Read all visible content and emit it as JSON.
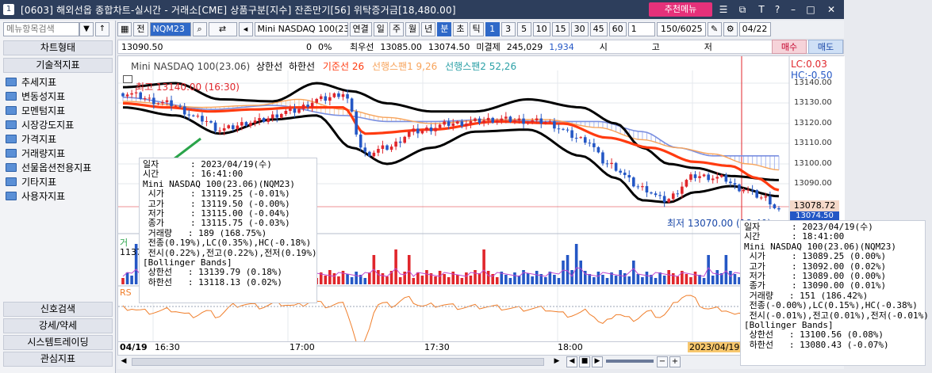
{
  "window": {
    "number": "1",
    "title": "[0603] 해외선옵 종합차트-실시간 - 거래소[CME] 상품구분[지수] 잔존만기[56] 위탁증거금[18,480.00]",
    "recommend_label": "추천메뉴"
  },
  "left_panel": {
    "search_placeholder": "메뉴항목검색",
    "chart_type_label": "차트형태",
    "indicators_label": "기술적지표",
    "tree": [
      "추세지표",
      "변동성지표",
      "모멘텀지표",
      "시장강도지표",
      "가격지표",
      "거래량지표",
      "선물옵션전용지표",
      "기타지표",
      "사용자지표"
    ],
    "bottom": [
      "신호검색",
      "강세/약세",
      "시스템트레이딩",
      "관심지표"
    ]
  },
  "toolbar": {
    "jeon": "전",
    "symbol": "NQM23",
    "name": "Mini NASDAQ 100(23.0",
    "periods": [
      "연결",
      "일",
      "주",
      "월",
      "년",
      "분",
      "초",
      "틱"
    ],
    "selected_period": "분",
    "intervals": [
      "1",
      "3",
      "5",
      "10",
      "15",
      "30",
      "45",
      "60"
    ],
    "selected_interval": "1",
    "interval_value": "1",
    "count": "150/6025",
    "date": "04/22"
  },
  "pricebar": {
    "price": "13090.50",
    "change": "0",
    "pct": "0%",
    "bid_label": "최우선",
    "bid": "13085.00",
    "ask": "13074.50",
    "oi_label": "미결제",
    "oi": "245,029",
    "oi_change": "1,934",
    "open_label": "시",
    "high_label": "고",
    "low_label": "저",
    "buy_label": "매수",
    "sell_label": "매도"
  },
  "chart": {
    "legend_symbol": "Mini NASDAQ 100(23.06)",
    "legend_upper": "상한선",
    "legend_lower": "하한선",
    "legend_kijun": "기준선 26",
    "legend_span1": "선행스팬1 9,26",
    "legend_span2": "선행스팬2 52,26",
    "lc": "LC:0.03",
    "hc": "HC:-0.50",
    "hi_label": "최고 13140.00 (16:30)",
    "lo_label": "최저 13070.00 (18:40)",
    "price_tag": "13078.72",
    "price_tag2": "13074.50",
    "volume_label": "거",
    "volume_val": "1137",
    "rsi_label": "RS",
    "y_ticks": [
      "13140.00",
      "13130.00",
      "13120.00",
      "13110.00",
      "13100.00",
      "13090.00"
    ],
    "x_date": "04/19",
    "x_ticks": [
      "16:30",
      "17:00",
      "17:30",
      "18:00"
    ],
    "x_tag": "2023/04/19("
  },
  "tooltip1": [
    "일자      : 2023/04/19(수)",
    "시간      : 16:41:00",
    "Mini NASDAQ 100(23.06)(NQM23)",
    " 시가     : 13119.25 (-0.01%)",
    " 고가     : 13119.50 (-0.00%)",
    " 저가     : 13115.00 (-0.04%)",
    " 종가     : 13115.75 (-0.03%)",
    " 거래량   : 189 (168.75%)",
    " 전종(0.19%),LC(0.35%),HC(-0.18%)",
    " 전시(0.22%),전고(0.22%),전저(0.19%)",
    "[Bollinger Bands]",
    " 상한선   : 13139.79 (0.18%)",
    " 하한선   : 13118.13 (0.02%)"
  ],
  "tooltip2": [
    "일자      : 2023/04/19(수)",
    "시간      : 18:41:00",
    "Mini NASDAQ 100(23.06)(NQM23)",
    " 시가     : 13089.25 (0.00%)",
    " 고가     : 13092.00 (0.02%)",
    " 저가     : 13089.00 (0.00%)",
    " 종가     : 13090.00 (0.01%)",
    " 거래량   : 151 (186.42%)",
    " 전종(-0.00%),LC(0.15%),HC(-0.38%)",
    " 전시(-0.01%),전고(0.01%),전저(-0.01%)",
    "[Bollinger Bands]",
    " 상한선   : 13100.56 (0.08%)",
    " 하한선   : 13080.43 (-0.07%)"
  ],
  "colors": {
    "up": "#e0262b",
    "down": "#2457c5",
    "kijun": "#ff3b10",
    "upper": "#000000",
    "span1": "#f7a35a",
    "span2": "#7a8fe0",
    "title_bg": "#2d3e5c",
    "rec": "#e5317a"
  }
}
